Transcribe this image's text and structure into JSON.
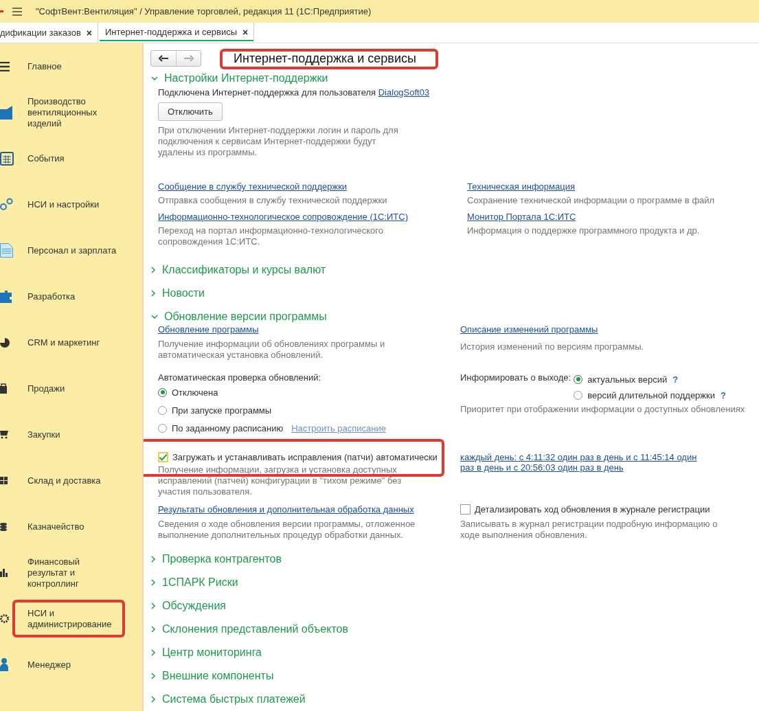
{
  "window": {
    "title": "\"СофтВент:Вентиляция\" / Управление торговлей, редакция 11  (1С:Предприятие)"
  },
  "tabs": [
    {
      "label": "дификации заказов",
      "selected": false,
      "close": "×"
    },
    {
      "label": "Интернет-поддержка и сервисы",
      "selected": true,
      "close": "×"
    }
  ],
  "sidebar": {
    "items": [
      {
        "label": "Главное",
        "highlighted": false
      },
      {
        "label": "Производство вентиляционных изделий",
        "highlighted": false
      },
      {
        "label": "События",
        "highlighted": false
      },
      {
        "label": "НСИ и настройки",
        "highlighted": false
      },
      {
        "label": "Персонал и зарплата",
        "highlighted": false
      },
      {
        "label": "Разработка",
        "highlighted": false
      },
      {
        "label": "CRM и маркетинг",
        "highlighted": false
      },
      {
        "label": "Продажи",
        "highlighted": false
      },
      {
        "label": "Закупки",
        "highlighted": false
      },
      {
        "label": "Склад и доставка",
        "highlighted": false
      },
      {
        "label": "Казначейство",
        "highlighted": false
      },
      {
        "label": "Финансовый результат и контроллинг",
        "highlighted": false
      },
      {
        "label": "НСИ и администрирование",
        "highlighted": true
      },
      {
        "label": "Менеджер",
        "highlighted": false
      }
    ]
  },
  "page": {
    "title": "Интернет-поддержка и сервисы",
    "highlighted": true
  },
  "sections": [
    {
      "title": "Настройки Интернет-поддержки",
      "expanded": true,
      "kind": "support",
      "status": "Подключена Интернет-поддержка для пользователя",
      "user_link": "DialogSoft03",
      "button": "Отключить",
      "note": "При отключении Интернет-поддержки логин и пароль для подключения к сервисам Интернет-поддержки будут удалены из программы.",
      "links": [
        {
          "label": "Сообщение в службу технической поддержки",
          "description": "Отправка сообщения в службу технической поддержки"
        },
        {
          "label": "Техническая информация",
          "description": "Сохранение технической информации о программе в файл"
        },
        {
          "label": "Информационно-технологическое сопровождение (1С:ИТС)",
          "description": "Переход на портал информационно-технологического сопровождения 1С:ИТС."
        },
        {
          "label": "Монитор Портала 1С:ИТС",
          "description": "Информация о поддержке программного продукта и др."
        }
      ]
    },
    {
      "title": "Классификаторы и курсы валют",
      "expanded": false,
      "kind": "plain"
    },
    {
      "title": "Новости",
      "expanded": false,
      "kind": "plain"
    },
    {
      "title": "Обновление версии программы",
      "expanded": true,
      "kind": "update",
      "update_link": "Обновление программы",
      "update_desc": "Получение информации об обновлениях программы и автоматическая установка обновлений.",
      "changes_link": "Описание изменений программы",
      "changes_desc": "История изменений по версиям программы.",
      "auto_check": {
        "label": "Автоматическая проверка обновлений:",
        "options": [
          {
            "label": "Отключена",
            "selected": true
          },
          {
            "label": "При запуске программы",
            "selected": false
          },
          {
            "label": "По заданному расписанию",
            "selected": false,
            "link": "Настроить расписание"
          }
        ]
      },
      "inform": {
        "label": "Информировать о выходе:",
        "options": [
          {
            "label": "актуальных версий",
            "selected": true,
            "help": "?"
          },
          {
            "label": "версий длительной поддержки",
            "selected": false,
            "help": "?"
          }
        ],
        "note": "Приоритет при отображении информации о доступных обновлениях"
      },
      "patches": {
        "label": "Загружать и устанавливать исправления (патчи) автоматически",
        "checked": true,
        "highlighted": true,
        "description": "Получение информации, загрузка и установка доступных исправлений (патчей) конфигурации в \"тихом режиме\" без участия пользователя."
      },
      "schedule_link": "каждый день: с 4:11:32 один раз в день и с 11:45:14 один раз в день и с 20:56:03 один раз в день",
      "results_link": "Результаты обновления и дополнительная обработка данных",
      "results_desc": "Сведения о ходе обновления версии программы, отложенное выполнение дополнительных процедур обработки данных.",
      "detail": {
        "label": "Детализировать ход обновления в журнале регистрации",
        "checked": false,
        "description": "Записывать в журнал регистрации подробную информацию о ходе выполнения обновления."
      }
    },
    {
      "title": "Проверка контрагентов",
      "expanded": false,
      "kind": "plain"
    },
    {
      "title": "1СПАРК Риски",
      "expanded": false,
      "kind": "plain"
    },
    {
      "title": "Обсуждения",
      "expanded": false,
      "kind": "plain"
    },
    {
      "title": "Склонения представлений объектов",
      "expanded": false,
      "kind": "plain"
    },
    {
      "title": "Центр мониторинга",
      "expanded": false,
      "kind": "plain"
    },
    {
      "title": "Внешние компоненты",
      "expanded": false,
      "kind": "plain"
    },
    {
      "title": "Система быстрых платежей",
      "expanded": false,
      "kind": "plain"
    }
  ]
}
